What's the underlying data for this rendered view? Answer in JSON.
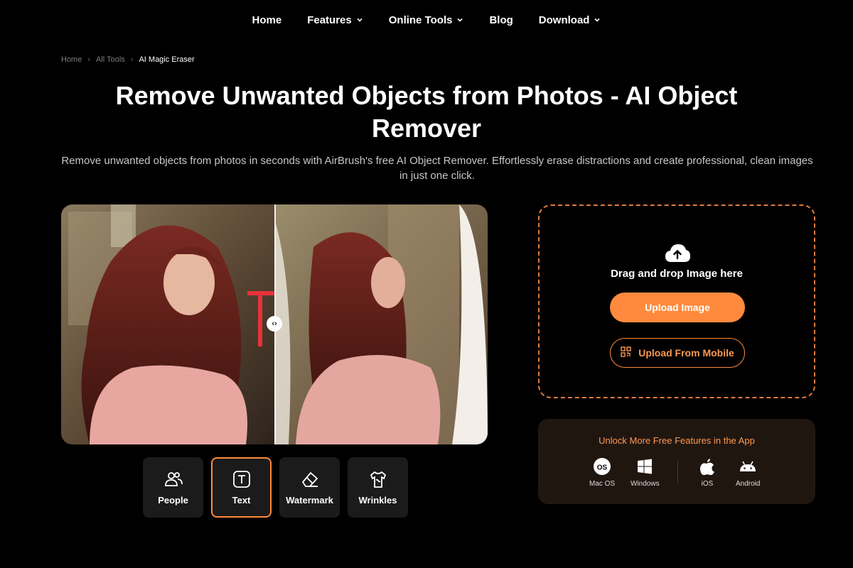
{
  "nav": {
    "items": [
      {
        "label": "Home",
        "has_dropdown": false
      },
      {
        "label": "Features",
        "has_dropdown": true
      },
      {
        "label": "Online Tools",
        "has_dropdown": true
      },
      {
        "label": "Blog",
        "has_dropdown": false
      },
      {
        "label": "Download",
        "has_dropdown": true
      }
    ]
  },
  "breadcrumb": {
    "items": [
      "Home",
      "All Tools",
      "AI Magic Eraser"
    ]
  },
  "hero": {
    "title": "Remove Unwanted Objects from Photos - AI Object Remover",
    "subtitle": "Remove unwanted objects from photos in seconds with AirBrush's free AI Object Remover. Effortlessly erase distractions and create professional, clean images in just one click."
  },
  "compare": {
    "handle_icon": "arrows-left-right-icon"
  },
  "categories": [
    {
      "label": "People",
      "icon": "people-icon",
      "active": false
    },
    {
      "label": "Text",
      "icon": "text-icon",
      "active": true
    },
    {
      "label": "Watermark",
      "icon": "eraser-icon",
      "active": false
    },
    {
      "label": "Wrinkles",
      "icon": "shirt-icon",
      "active": false
    }
  ],
  "upload": {
    "drag_text": "Drag and drop Image here",
    "upload_label": "Upload Image",
    "mobile_label": "Upload From Mobile"
  },
  "apps": {
    "heading": "Unlock More Free Features in the App",
    "platforms": [
      {
        "label": "Mac OS",
        "icon": "macos-icon"
      },
      {
        "label": "Windows",
        "icon": "windows-icon"
      },
      {
        "label": "iOS",
        "icon": "apple-icon"
      },
      {
        "label": "Android",
        "icon": "android-icon"
      }
    ]
  },
  "colors": {
    "accent": "#ff8a3d",
    "background": "#000000",
    "panel": "#201610"
  }
}
